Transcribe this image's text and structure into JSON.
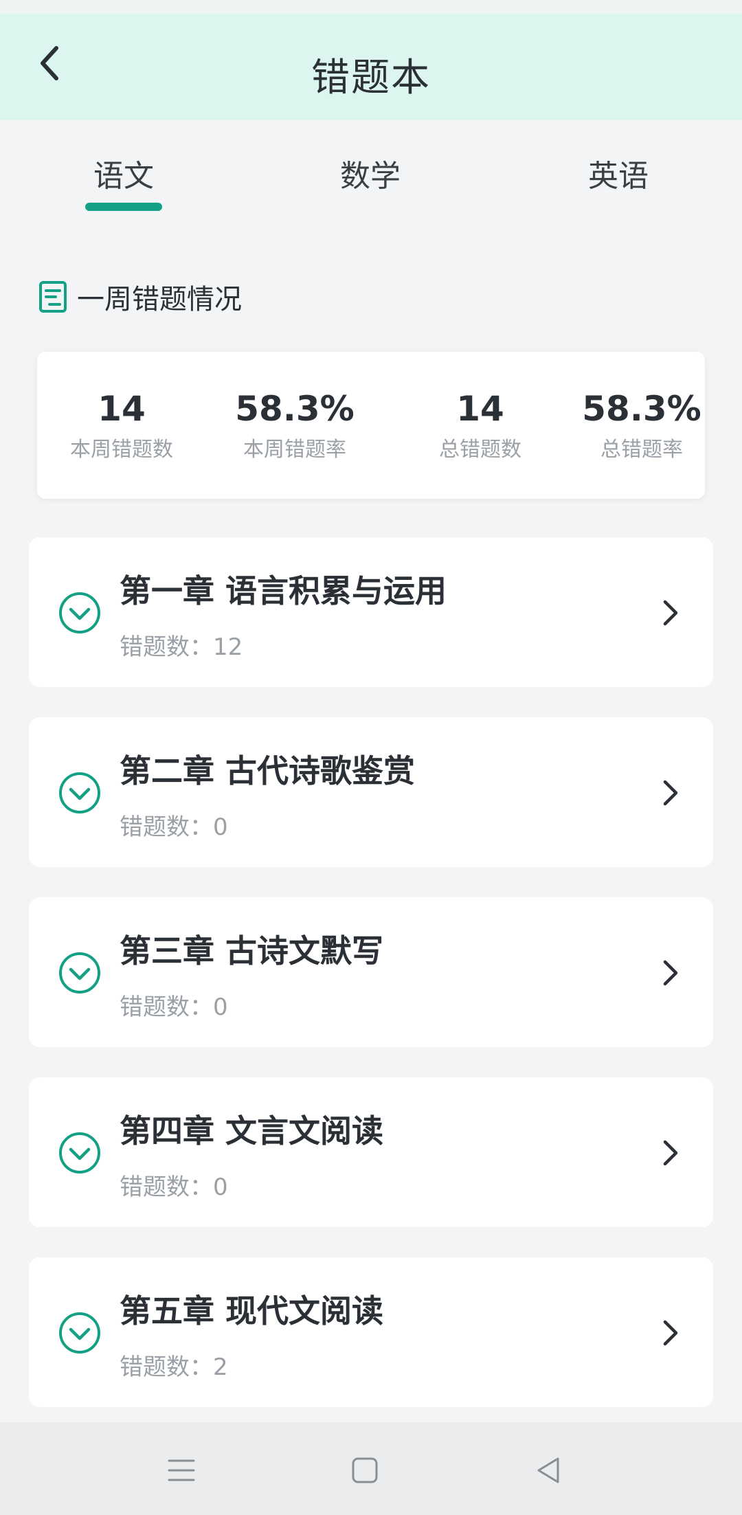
{
  "header": {
    "title": "错题本",
    "background_color": "#dcf6ef"
  },
  "tabs": [
    {
      "label": "语文",
      "active": true
    },
    {
      "label": "数学",
      "active": false
    },
    {
      "label": "英语",
      "active": false
    }
  ],
  "accent_color": "#14a085",
  "section": {
    "title": "一周错题情况",
    "icon": "document-icon"
  },
  "stats": [
    {
      "value": "14",
      "label": "本周错题数"
    },
    {
      "value": "58.3%",
      "label": "本周错题率"
    },
    {
      "value": "14",
      "label": "总错题数"
    },
    {
      "value": "58.3%",
      "label": "总错题率"
    }
  ],
  "chapters": [
    {
      "title": "第一章 语言积累与运用",
      "count_label": "错题数：",
      "count": "12"
    },
    {
      "title": "第二章 古代诗歌鉴赏",
      "count_label": "错题数：",
      "count": "0"
    },
    {
      "title": "第三章 古诗文默写",
      "count_label": "错题数：",
      "count": "0"
    },
    {
      "title": "第四章 文言文阅读",
      "count_label": "错题数：",
      "count": "0"
    },
    {
      "title": "第五章 现代文阅读",
      "count_label": "错题数：",
      "count": "2"
    }
  ],
  "navbar": {
    "icons": [
      "menu-icon",
      "home-square-icon",
      "back-triangle-icon"
    ]
  }
}
